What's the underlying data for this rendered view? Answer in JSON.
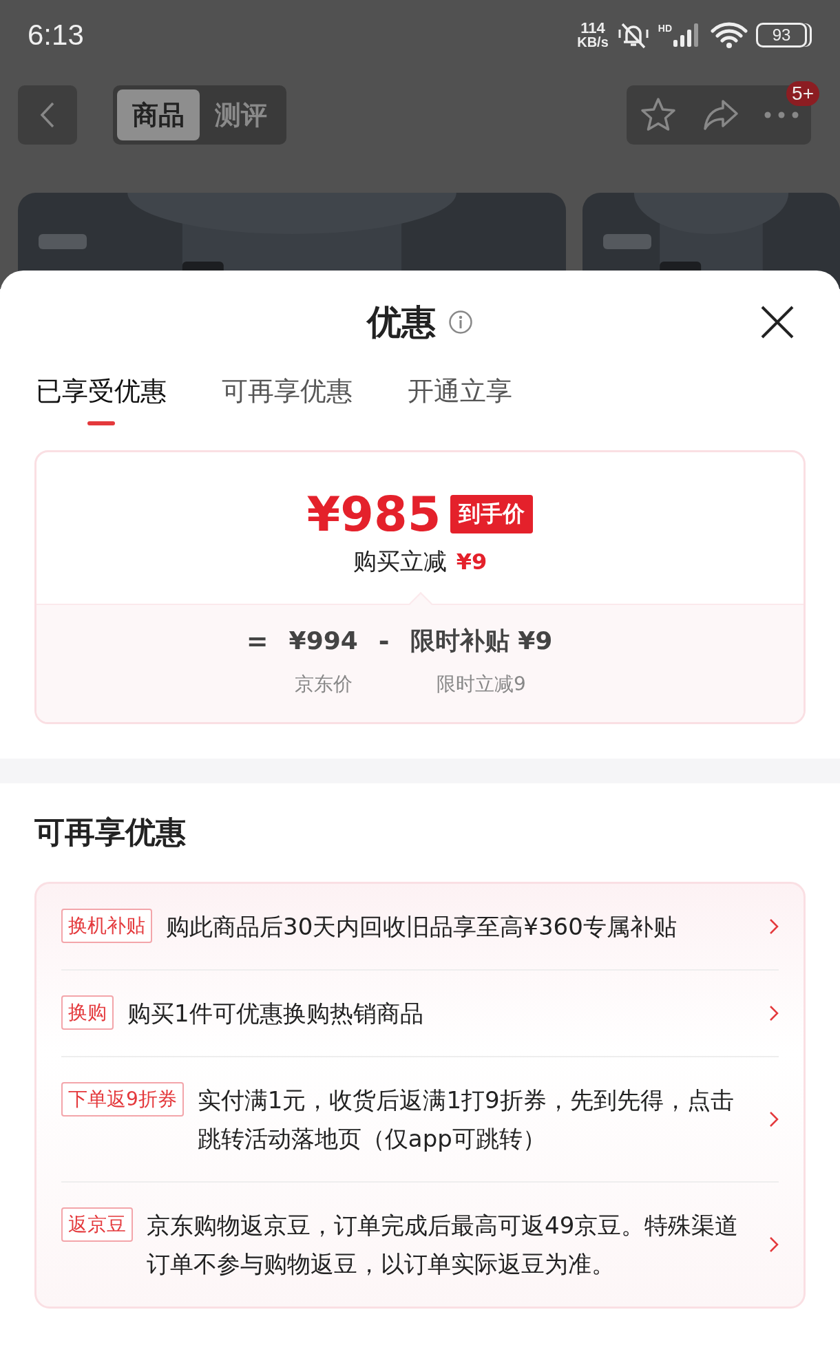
{
  "status_bar": {
    "time": "6:13",
    "net_speed_value": "114",
    "net_speed_unit": "KB/s",
    "hd_label": "HD",
    "battery": "93"
  },
  "nav": {
    "tabs": [
      {
        "label": "商品",
        "selected": true
      },
      {
        "label": "测评",
        "selected": false
      }
    ],
    "badge": "5+"
  },
  "sheet": {
    "title": "优惠",
    "tabs": [
      {
        "label": "已享受优惠",
        "selected": true
      },
      {
        "label": "可再享优惠",
        "selected": false
      },
      {
        "label": "开通立享",
        "selected": false
      }
    ],
    "price_card": {
      "final_price": "¥985",
      "price_tag": "到手价",
      "discount_label": "购买立减",
      "discount_amount": "¥9",
      "equals": "=",
      "operator": "-",
      "breakdown": [
        {
          "amount": "¥994",
          "caption": "京东价"
        },
        {
          "amount": "限时补贴 ¥9",
          "caption": "限时立减9"
        }
      ]
    },
    "more_offers": {
      "heading": "可再享优惠",
      "items": [
        {
          "tag": "换机补贴",
          "text": "购此商品后30天内回收旧品享至高¥360专属补贴"
        },
        {
          "tag": "换购",
          "text": "购买1件可优惠换购热销商品"
        },
        {
          "tag": "下单返9折券",
          "text": "实付满1元，收货后返满1打9折券，先到先得，点击跳转活动落地页（仅app可跳转）"
        },
        {
          "tag": "返京豆",
          "text": "京东购物返京豆，订单完成后最高可返49京豆。特殊渠道订单不参与购物返豆，以订单实际返豆为准。"
        }
      ]
    }
  }
}
